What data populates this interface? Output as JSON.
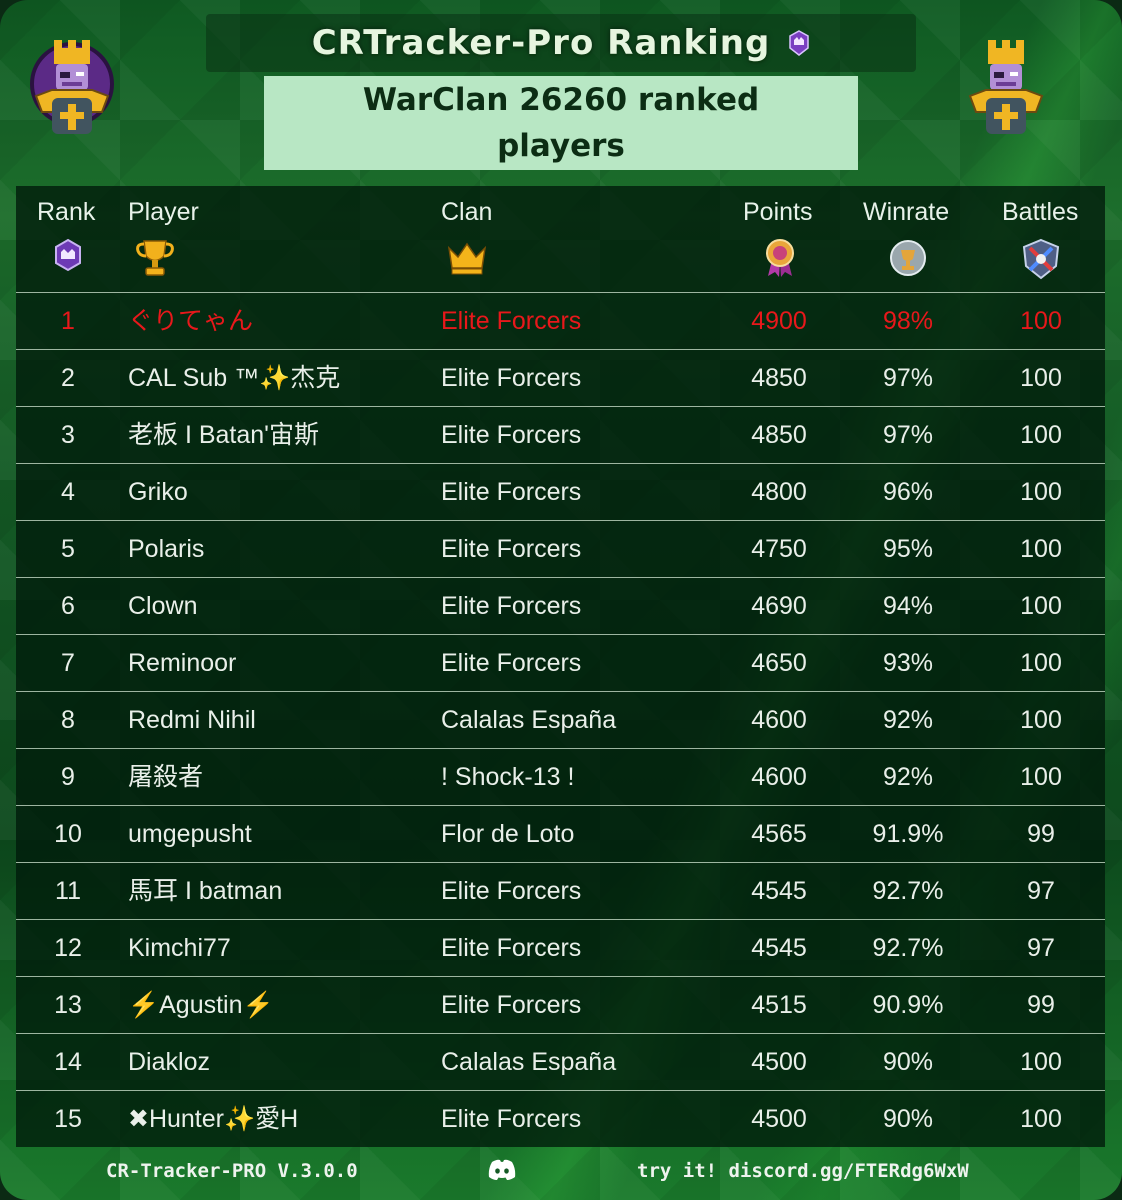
{
  "header": {
    "title": "CRTracker-Pro Ranking",
    "subtitle": "WarClan 26260 ranked players"
  },
  "columns": {
    "rank": "Rank",
    "player": "Player",
    "clan": "Clan",
    "points": "Points",
    "winrate": "Winrate",
    "battles": "Battles"
  },
  "column_icons": {
    "rank": "purple-crown-badge-icon",
    "player": "trophy-icon",
    "clan": "gold-crown-icon",
    "points": "medal-icon",
    "winrate": "silver-trophy-badge-icon",
    "battles": "crossed-swords-shield-icon"
  },
  "rows": [
    {
      "rank": "1",
      "player": "ぐりてゃん",
      "clan": "Elite Forcers",
      "points": "4900",
      "winrate": "98%",
      "battles": "100"
    },
    {
      "rank": "2",
      "player": "CAL Sub ™✨杰克",
      "clan": "Elite Forcers",
      "points": "4850",
      "winrate": "97%",
      "battles": "100"
    },
    {
      "rank": "3",
      "player": "老板 I Batan'宙斯",
      "clan": "Elite Forcers",
      "points": "4850",
      "winrate": "97%",
      "battles": "100"
    },
    {
      "rank": "4",
      "player": "Griko",
      "clan": "Elite Forcers",
      "points": "4800",
      "winrate": "96%",
      "battles": "100"
    },
    {
      "rank": "5",
      "player": "Polaris",
      "clan": "Elite Forcers",
      "points": "4750",
      "winrate": "95%",
      "battles": "100"
    },
    {
      "rank": "6",
      "player": "Clown",
      "clan": "Elite Forcers",
      "points": "4690",
      "winrate": "94%",
      "battles": "100"
    },
    {
      "rank": "7",
      "player": "Reminoor",
      "clan": "Elite Forcers",
      "points": "4650",
      "winrate": "93%",
      "battles": "100"
    },
    {
      "rank": "8",
      "player": "Redmi Nihil",
      "clan": "Calalas España",
      "points": "4600",
      "winrate": "92%",
      "battles": "100"
    },
    {
      "rank": "9",
      "player": "屠殺者",
      "clan": "! Shock-13 !",
      "points": "4600",
      "winrate": "92%",
      "battles": "100"
    },
    {
      "rank": "10",
      "player": "umgepusht",
      "clan": "Flor de Loto",
      "points": "4565",
      "winrate": "91.9%",
      "battles": "99"
    },
    {
      "rank": "11",
      "player": "馬耳 I batman",
      "clan": "Elite Forcers",
      "points": "4545",
      "winrate": "92.7%",
      "battles": "97"
    },
    {
      "rank": "12",
      "player": "Kimchi77",
      "clan": "Elite Forcers",
      "points": "4545",
      "winrate": "92.7%",
      "battles": "97"
    },
    {
      "rank": "13",
      "player": "⚡Agustin⚡",
      "clan": "Elite Forcers",
      "points": "4515",
      "winrate": "90.9%",
      "battles": "99"
    },
    {
      "rank": "14",
      "player": "Diakloz",
      "clan": "Calalas España",
      "points": "4500",
      "winrate": "90%",
      "battles": "100"
    },
    {
      "rank": "15",
      "player": "✖Hunter✨愛H",
      "clan": "Elite Forcers",
      "points": "4500",
      "winrate": "90%",
      "battles": "100"
    }
  ],
  "footer": {
    "version": "CR-Tracker-PRO V.3.0.0",
    "link_text": "try it! discord.gg/FTERdg6WxW",
    "icon": "discord-icon"
  },
  "colors": {
    "leader_text": "#e8181b",
    "subtitle_bg": "#b8e7c4",
    "background": "#145a25"
  }
}
